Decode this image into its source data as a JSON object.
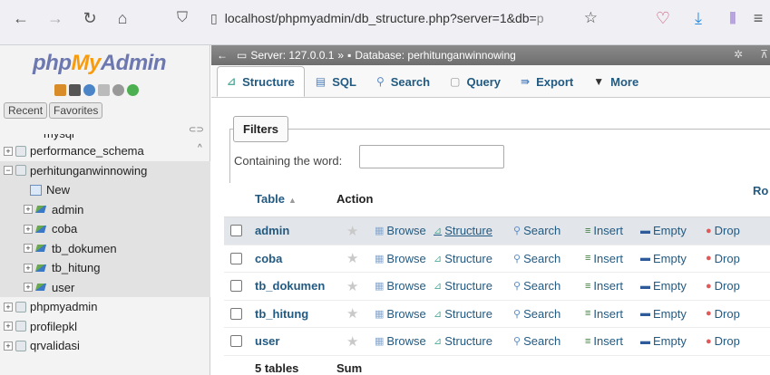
{
  "browser": {
    "url_main": "localhost/phpmyadmin/db_structure.php?server=1&db=",
    "url_faded": "p",
    "icons": [
      "back-arrow-icon",
      "forward-arrow-icon",
      "reload-icon",
      "home-icon",
      "shield-icon",
      "page-icon",
      "star-icon",
      "pocket-icon",
      "download-icon",
      "library-icon",
      "menu-icon"
    ]
  },
  "nav": {
    "logo_php": "php",
    "logo_my": "My",
    "logo_admin": "Admin",
    "recent": "Recent",
    "favorites": "Favorites",
    "tree_cut": "mysql",
    "items": [
      {
        "label": "performance_schema"
      },
      {
        "label": "perhitunganwinnowing"
      },
      {
        "label": "New"
      },
      {
        "label": "admin"
      },
      {
        "label": "coba"
      },
      {
        "label": "tb_dokumen"
      },
      {
        "label": "tb_hitung"
      },
      {
        "label": "user"
      },
      {
        "label": "phpmyadmin"
      },
      {
        "label": "profilepkl"
      },
      {
        "label": "qrvalidasi"
      }
    ]
  },
  "main": {
    "breadcrumb_server": "Server: 127.0.0.1",
    "breadcrumb_sep": "»",
    "breadcrumb_db": "Database: perhitunganwinnowing",
    "tabs": [
      "Structure",
      "SQL",
      "Search",
      "Query",
      "Export",
      "More"
    ],
    "filters": {
      "legend": "Filters",
      "label": "Containing the word:",
      "value": ""
    },
    "table": {
      "col_table": "Table",
      "col_action": "Action",
      "col_rows_cut": "Ro",
      "actions": [
        "Browse",
        "Structure",
        "Search",
        "Insert",
        "Empty",
        "Drop"
      ],
      "rows": [
        {
          "name": "admin"
        },
        {
          "name": "coba"
        },
        {
          "name": "tb_dokumen"
        },
        {
          "name": "tb_hitung"
        },
        {
          "name": "user"
        }
      ],
      "footer_count": "5 tables",
      "footer_sum": "Sum"
    }
  }
}
